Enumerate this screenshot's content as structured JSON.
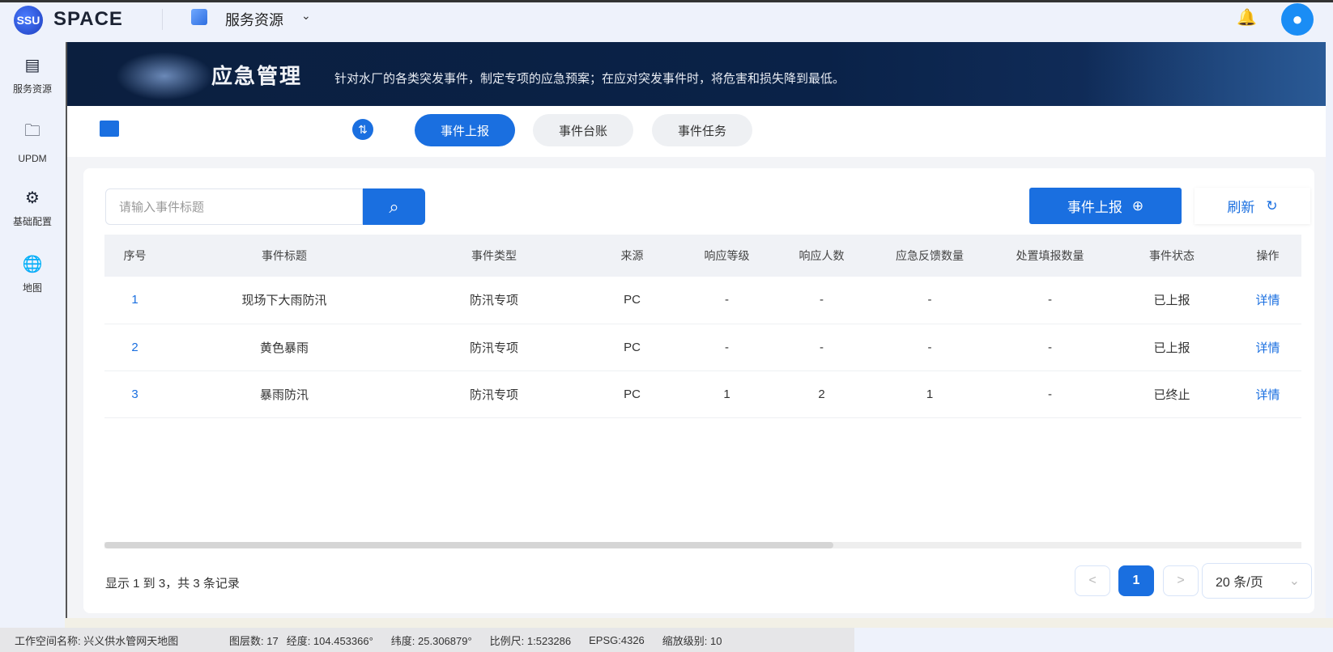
{
  "topbar": {
    "logo_text": "SSU",
    "brand": "SPACE",
    "service_menu": "服务资源",
    "icons": {
      "bell": "bell-icon",
      "avatar": "user-avatar-icon"
    }
  },
  "sidebar": {
    "items": [
      {
        "label": "服务资源",
        "icon": "document-icon"
      },
      {
        "label": "UPDM",
        "icon": "folder-icon"
      },
      {
        "label": "基础配置",
        "icon": "gear-icon"
      },
      {
        "label": "地图",
        "icon": "globe-icon"
      }
    ]
  },
  "banner": {
    "title": "应急管理",
    "description": "针对水厂的各类突发事件，制定专项的应急预案；在应对突发事件时，将危害和损失降到最低。"
  },
  "tabs": [
    {
      "label": "事件上报",
      "active": true
    },
    {
      "label": "事件台账",
      "active": false
    },
    {
      "label": "事件任务",
      "active": false
    }
  ],
  "toolbar": {
    "search_placeholder": "请输入事件标题",
    "report_button": "事件上报",
    "refresh_button": "刷新"
  },
  "table": {
    "columns": [
      "序号",
      "事件标题",
      "事件类型",
      "来源",
      "响应等级",
      "响应人数",
      "应急反馈数量",
      "处置填报数量",
      "事件状态",
      "操作"
    ],
    "rows": [
      [
        "1",
        "现场下大雨防汛",
        "防汛专项",
        "PC",
        "-",
        "-",
        "-",
        "-",
        "已上报",
        "详情"
      ],
      [
        "2",
        "黄色暴雨",
        "防汛专项",
        "PC",
        "-",
        "-",
        "-",
        "-",
        "已上报",
        "详情"
      ],
      [
        "3",
        "暴雨防汛",
        "防汛专项",
        "PC",
        "1",
        "2",
        "1",
        "-",
        "已终止",
        "详情"
      ]
    ]
  },
  "pagination": {
    "summary": "显示 1 到 3，共 3 条记录",
    "prev": "<",
    "current": "1",
    "next": ">",
    "page_size": "20 条/页"
  },
  "statusbar": {
    "workspace": "工作空间名称: 兴义供水管网天地图",
    "layers": "图层数: 17",
    "lon": "经度: 104.453366°",
    "lat": "纬度: 25.306879°",
    "scale": "比例尺: 1:523286",
    "epsg": "EPSG:4326",
    "zoom": "缩放级别: 10"
  },
  "colors": {
    "accent": "#1a6fe0",
    "banner": "#0b1f3f"
  }
}
